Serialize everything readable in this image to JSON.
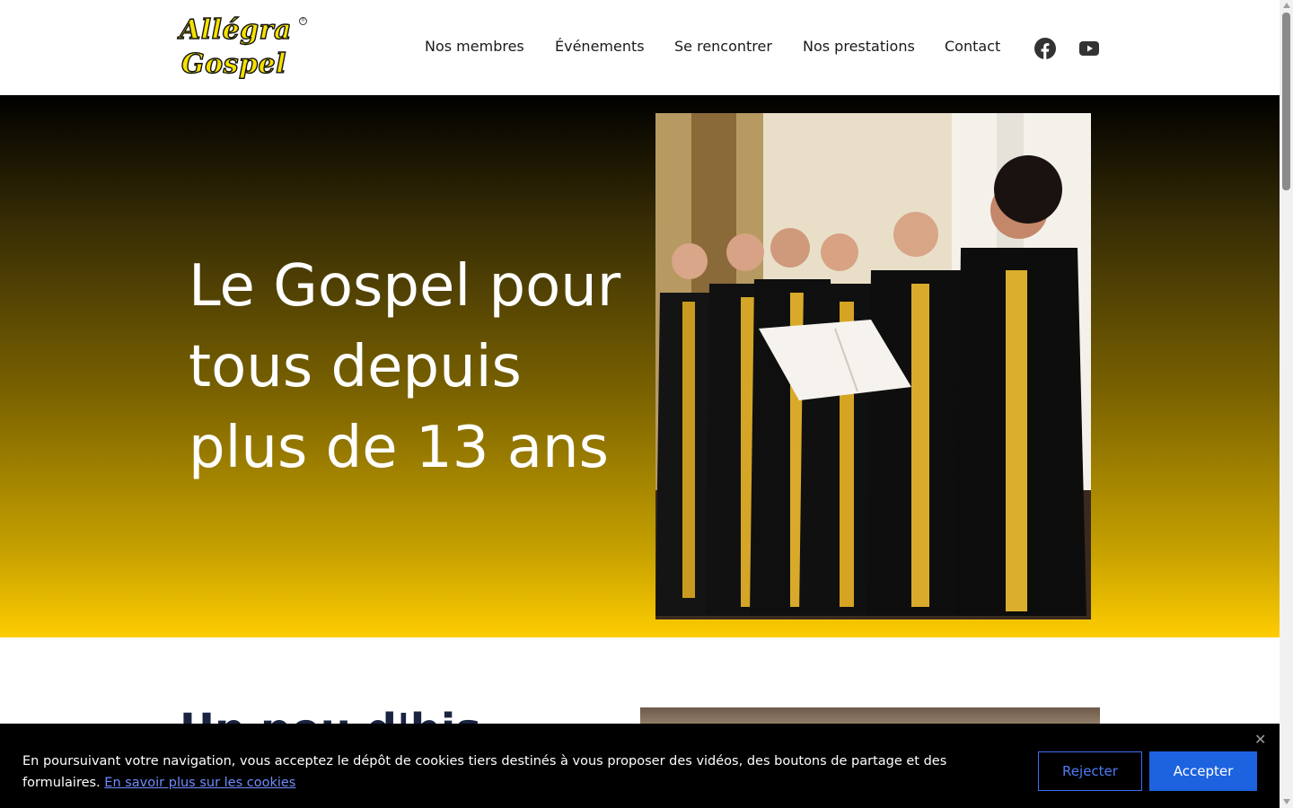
{
  "logo": {
    "line1": "Allégra",
    "line2": "Gospel",
    "mark": "®"
  },
  "nav": {
    "items": [
      "Nos membres",
      "Événements",
      "Se rencontrer",
      "Nos prestations",
      "Contact"
    ]
  },
  "social": {
    "facebook_icon": "facebook-icon",
    "youtube_icon": "youtube-icon"
  },
  "hero": {
    "title": "Le Gospel pour tous depuis plus de 13 ans",
    "image": "choir-singing-photo",
    "gradient_top": "#000000",
    "gradient_bottom": "#fecc00"
  },
  "section2": {
    "title_partial": "Un peu d'his"
  },
  "cookie": {
    "text": "En poursuivant votre navigation, vous acceptez le dépôt de cookies tiers destinés à vous proposer des vidéos, des boutons de partage et des formulaires.",
    "link_text": "En savoir plus sur les cookies",
    "reject_label": "Rejecter",
    "accept_label": "Accepter",
    "close_icon": "close-icon"
  },
  "colors": {
    "accent_blue": "#1d63e0",
    "brand_yellow": "#fecc00"
  }
}
